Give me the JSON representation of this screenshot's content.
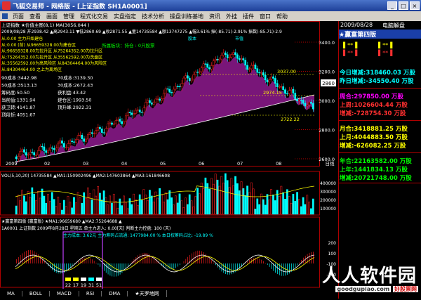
{
  "window": {
    "title": "飞狐交易师 - 网络版 - [上证指数 SH1A0001]"
  },
  "menu": [
    "页面",
    "查看",
    "画面",
    "管理",
    "程式化交易",
    "实盘指定",
    "技术分析",
    "操盘训练基地",
    "资讯",
    "外挂",
    "插件",
    "窗口",
    "帮助"
  ],
  "main_chart": {
    "header_line1": "上证指数  ★价值主图(8,1) MA(3056.044 )",
    "header_line2": "2009/08/28 开2938.42 ▲高2943.11 ▼低2860.69 ▲收2871.55 ▲量14735584 ▲额13747275 ▲幅3.61% 振(-85.71)-2.91% 振数(-85.71)-2.9",
    "stat_labels": [
      "从:0.00  主力开始建仓",
      "从:0.00          (前)  从96659328.00为建仓区",
      "从:96659328.00为拉升区  从75264352.00为拉升区",
      "从:75264352.00为拉升区  从35562592.00为洗盘区",
      "从:35562592.00为高风险区  从84304464.00为风险区",
      "从:84304464.00 之上为离场区"
    ],
    "data_rows": [
      [
        "90成本:3442.98",
        "70成本:3139.30"
      ],
      [
        "50成本:3513.13",
        "30成本:2672.43"
      ],
      [
        "筹码度:50.50",
        "获利盘:43.42"
      ],
      [
        "当前值:1331.94",
        "建仓区:1993.50"
      ],
      [
        "获卫转:4141.87",
        "顶升峰:2922.31"
      ],
      [
        "顶段折:4051.67",
        ""
      ]
    ],
    "zone_labels": [
      "所属板块：持仓 : 0只股票",
      "股本",
      "市值"
    ],
    "price_ticks": [
      "3400.0",
      "3200.0",
      "3000.0",
      "2800.0",
      "2600.0"
    ],
    "annotations": [
      "3037.00",
      "2974.15",
      "2722.22"
    ],
    "current_price": "2860",
    "x_ticks": [
      "2009",
      "02",
      "03",
      "04",
      "05",
      "06",
      "07",
      "08",
      "日线"
    ]
  },
  "volume_chart": {
    "header": "VOL(5,10,20)  14735584  ▲MA1:150902496  ▲MA2:147603864  ▲MA3:161846608",
    "ticks": [
      "400000",
      "300000",
      "200000",
      "100000"
    ]
  },
  "macd_chart": {
    "header1": "★赢富第四版 (赢富版)  ★MA1:96659680  ▲MA2:75264688 ▲",
    "header2": "1A0001   上证指数      2009年8月28日 星期五           单主力进入: 0.00[天]    判断主力控盘: 100 (天)",
    "header3": "主力成本: 3.62元            主力筹码占流通: 1477984.00 %    本日权筹码占比: -19.89 %",
    "numbers": [
      "22",
      "17",
      "19",
      "31",
      "51"
    ],
    "note": "散户主买主力主卖",
    "ticks": [
      "200",
      "100",
      "-100",
      "-200"
    ]
  },
  "tabs": [
    "MA",
    "BOLL",
    "MACD",
    "RSI",
    "DMA",
    "★天罗地网"
  ],
  "right_panel": {
    "date": "2009/08/28",
    "badge": "电脑解盘",
    "title": "★赢富第四版",
    "stars": [
      "**",
      "**",
      "**",
      "**"
    ],
    "rows": [
      {
        "label": "今日增减:",
        "value": "318460.03",
        "unit": "万股",
        "color": "#00ffff"
      },
      {
        "label": "昨日增减:",
        "value": "-34550.40",
        "unit": "万股",
        "color": "#00ffff"
      },
      {
        "label": "周合:",
        "value": "297850.00",
        "unit": "万股",
        "color": "#ff00ff"
      },
      {
        "label": "上周:",
        "value": "1026604.44",
        "unit": "万股",
        "color": "#ff3030"
      },
      {
        "label": "增减:",
        "value": "-728754.30",
        "unit": "万股",
        "color": "#ff3030"
      },
      {
        "label": "月合:",
        "value": "3418881.25",
        "unit": "万股",
        "color": "#ffff00"
      },
      {
        "label": "上月:",
        "value": "4044883.50",
        "unit": "万股",
        "color": "#ffff00"
      },
      {
        "label": "增减:",
        "value": "-626082.25",
        "unit": "万股",
        "color": "#ffff00"
      },
      {
        "label": "年合:",
        "value": "22163582.00",
        "unit": "万股",
        "color": "#00ff00"
      },
      {
        "label": "上年:",
        "value": "1441834.13",
        "unit": "万股",
        "color": "#00ff00"
      },
      {
        "label": "增减:",
        "value": "20721748.00",
        "unit": "万股",
        "color": "#00ff00"
      }
    ]
  },
  "watermark": {
    "big": "人人软件园",
    "site": "goodgupiao.com",
    "tag": "好股票网"
  },
  "colors": {
    "up": "#ff2020",
    "down": "#00ffff",
    "fill": "#8e1a8e",
    "grid": "#b00000",
    "accent": "#ffff00"
  }
}
